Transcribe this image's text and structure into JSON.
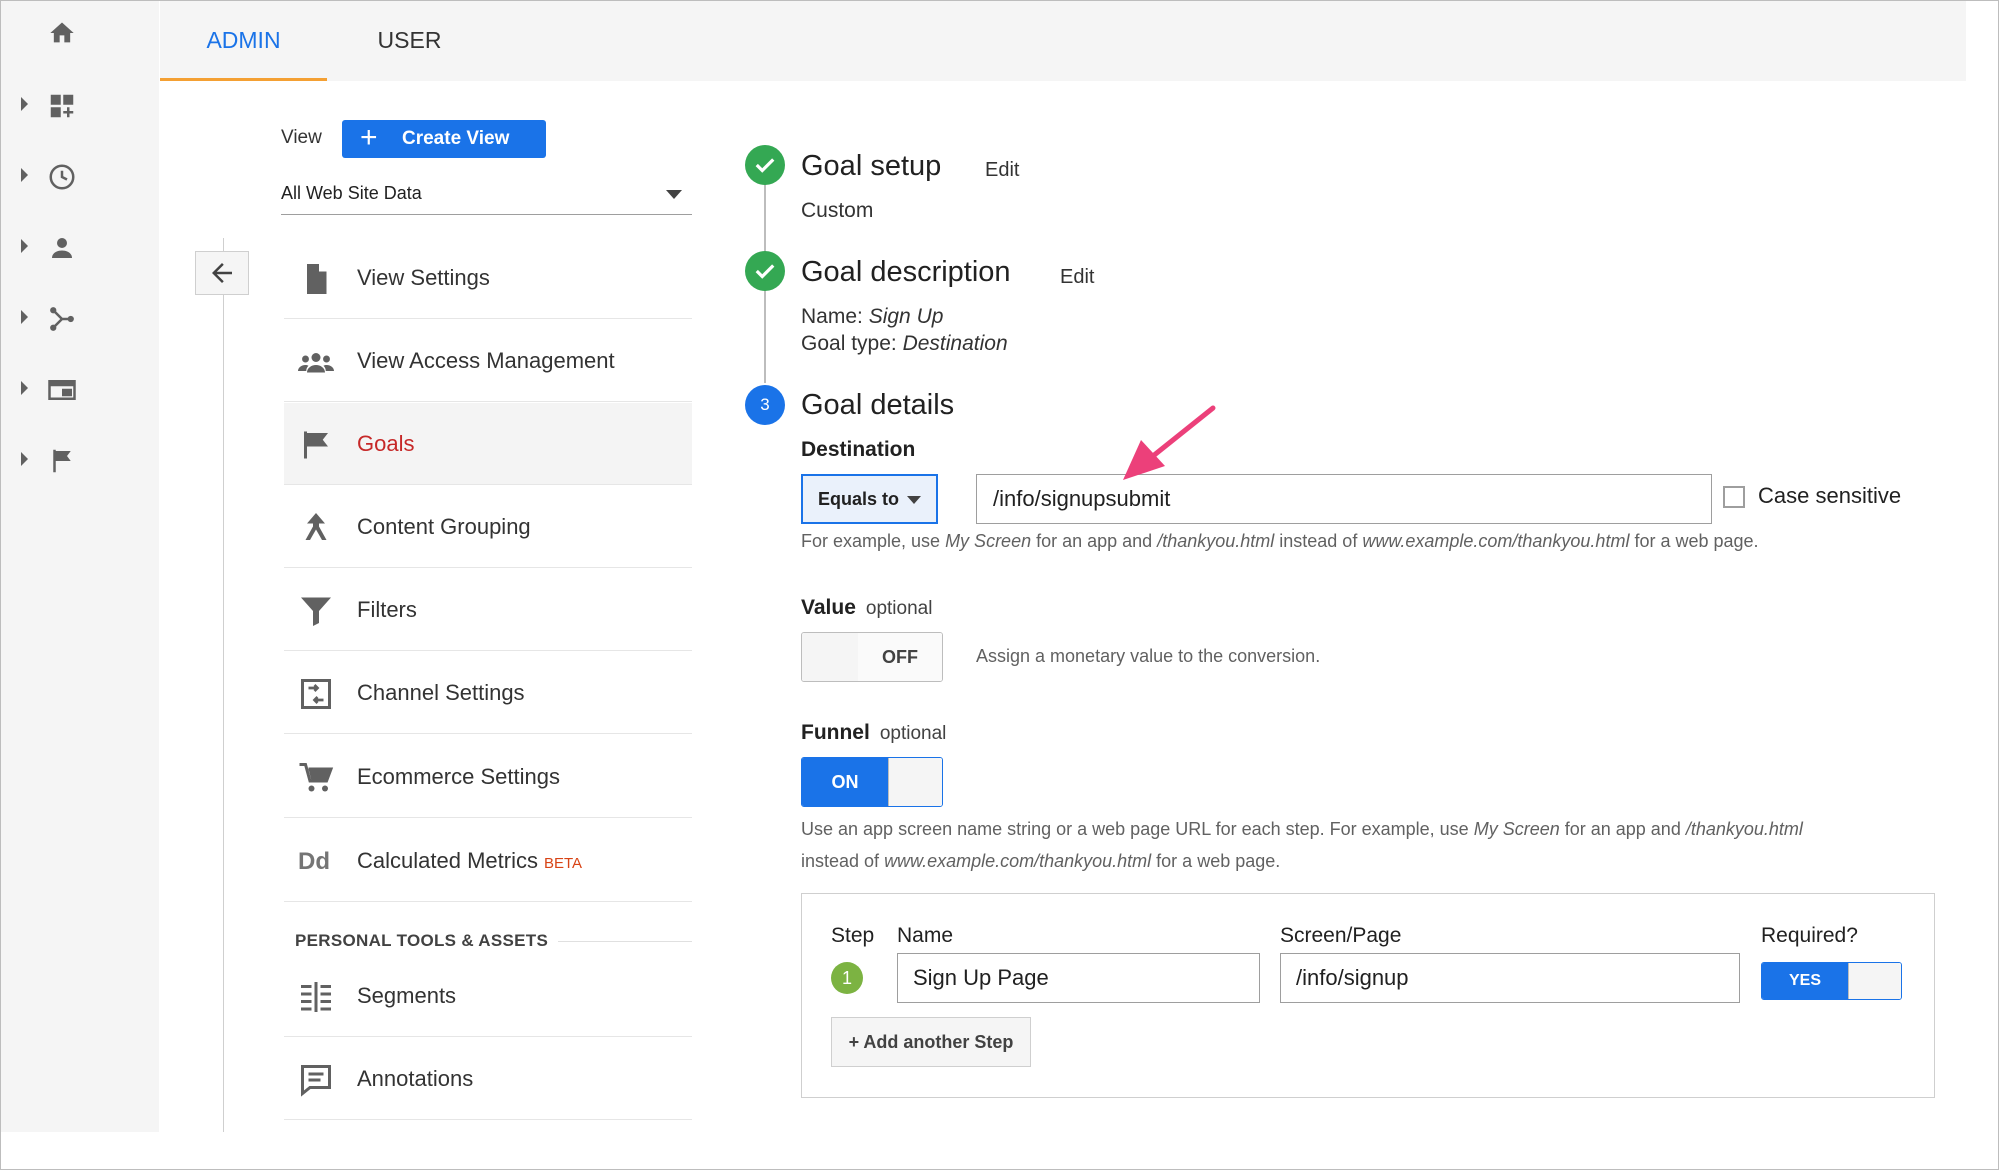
{
  "tabs": {
    "admin": "ADMIN",
    "user": "USER"
  },
  "view": {
    "label": "View",
    "create_button": "Create View",
    "selected": "All Web Site Data"
  },
  "nav": {
    "items": [
      {
        "label": "View Settings",
        "icon": "document-icon"
      },
      {
        "label": "View Access Management",
        "icon": "people-icon"
      },
      {
        "label": "Goals",
        "icon": "flag-icon",
        "active": true
      },
      {
        "label": "Content Grouping",
        "icon": "grouping-icon"
      },
      {
        "label": "Filters",
        "icon": "funnel-icon"
      },
      {
        "label": "Channel Settings",
        "icon": "channel-icon"
      },
      {
        "label": "Ecommerce Settings",
        "icon": "cart-icon"
      },
      {
        "label": "Calculated Metrics",
        "icon": "dd-icon",
        "badge": "BETA",
        "icon_text": "Dd"
      }
    ],
    "section_title": "PERSONAL TOOLS & ASSETS",
    "personal": [
      {
        "label": "Segments",
        "icon": "segments-icon"
      },
      {
        "label": "Annotations",
        "icon": "comment-icon"
      }
    ]
  },
  "goal_setup": {
    "title": "Goal setup",
    "edit": "Edit",
    "value": "Custom"
  },
  "goal_description": {
    "title": "Goal description",
    "edit": "Edit",
    "name_label": "Name:",
    "name_value": "Sign Up",
    "type_label": "Goal type:",
    "type_value": "Destination"
  },
  "goal_details": {
    "step_number": "3",
    "title": "Goal details",
    "destination_label": "Destination",
    "match_type": "Equals to",
    "destination_value": "/info/signupsubmit",
    "case_sensitive_label": "Case sensitive",
    "dest_hint": {
      "p1": "For example, use ",
      "i1": "My Screen",
      "p2": " for an app and ",
      "i2": "/thankyou.html",
      "p3": " instead of ",
      "i3": "www.example.com/thankyou.html",
      "p4": " for a web page."
    },
    "value_label": "Value",
    "value_optional": "optional",
    "value_toggle": "OFF",
    "value_hint": "Assign a monetary value to the conversion.",
    "funnel_label": "Funnel",
    "funnel_optional": "optional",
    "funnel_toggle": "ON",
    "funnel_hint": {
      "p1": "Use an app screen name string or a web page URL for each step. For example, use ",
      "i1": "My Screen",
      "p2": " for an app and ",
      "i2": "/thankyou.html",
      "p3": "instead of ",
      "i3": "www.example.com/thankyou.html",
      "p4": " for a web page."
    }
  },
  "funnel_table": {
    "headers": {
      "step": "Step",
      "name": "Name",
      "screen": "Screen/Page",
      "required": "Required?"
    },
    "rows": [
      {
        "step": "1",
        "name": "Sign Up Page",
        "screen": "/info/signup",
        "required": "YES"
      }
    ],
    "add_step": "+ Add another Step"
  },
  "colors": {
    "accent": "#1a73e8",
    "success": "#34a853",
    "active_nav": "#c62828",
    "tab_underline": "#f4a033",
    "arrow": "#ec407a"
  }
}
